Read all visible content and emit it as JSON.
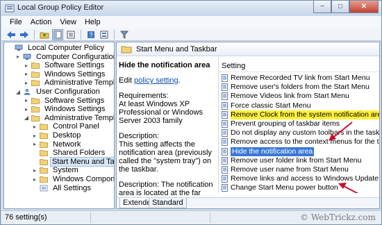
{
  "window": {
    "title": "Local Group Policy Editor",
    "controls": {
      "minimize": "−",
      "maximize": "□",
      "close": "✕"
    }
  },
  "menu": {
    "items": [
      "File",
      "Action",
      "View",
      "Help"
    ]
  },
  "toolbar": {
    "icons": [
      "back-arrow-icon",
      "forward-arrow-icon",
      "up-folder-icon",
      "show-hide-tree-icon",
      "export-list-icon",
      "help-icon",
      "properties-icon",
      "filter-icon"
    ]
  },
  "tree": {
    "items": [
      {
        "label": "Local Computer Policy",
        "level": 0,
        "icon": "computer-icon",
        "expander": ""
      },
      {
        "label": "Computer Configuration",
        "level": 1,
        "icon": "computer-icon",
        "expander": "▸"
      },
      {
        "label": "Software Settings",
        "level": 2,
        "icon": "folder-icon",
        "expander": "▸"
      },
      {
        "label": "Windows Settings",
        "level": 2,
        "icon": "folder-icon",
        "expander": "▸"
      },
      {
        "label": "Administrative Templates",
        "level": 2,
        "icon": "folder-icon",
        "expander": "▸"
      },
      {
        "label": "User Configuration",
        "level": 1,
        "icon": "user-icon",
        "expander": "◢"
      },
      {
        "label": "Software Settings",
        "level": 2,
        "icon": "folder-icon",
        "expander": "▸"
      },
      {
        "label": "Windows Settings",
        "level": 2,
        "icon": "folder-icon",
        "expander": "▸"
      },
      {
        "label": "Administrative Templates",
        "level": 2,
        "icon": "folder-icon",
        "expander": "◢"
      },
      {
        "label": "Control Panel",
        "level": 3,
        "icon": "folder-icon",
        "expander": "▸"
      },
      {
        "label": "Desktop",
        "level": 3,
        "icon": "folder-icon",
        "expander": "▸"
      },
      {
        "label": "Network",
        "level": 3,
        "icon": "folder-icon",
        "expander": "▸"
      },
      {
        "label": "Shared Folders",
        "level": 3,
        "icon": "folder-icon",
        "expander": ""
      },
      {
        "label": "Start Menu and Taskbar",
        "level": 3,
        "icon": "folder-icon",
        "expander": "",
        "selected": true
      },
      {
        "label": "System",
        "level": 3,
        "icon": "folder-icon",
        "expander": "▸"
      },
      {
        "label": "Windows Components",
        "level": 3,
        "icon": "folder-icon",
        "expander": "▸"
      },
      {
        "label": "All Settings",
        "level": 3,
        "icon": "settings-icon",
        "expander": ""
      }
    ]
  },
  "details": {
    "header": "Start Menu and Taskbar",
    "title": "Hide the notification area",
    "edit_prefix": "Edit ",
    "edit_link": "policy setting",
    "edit_suffix": ".",
    "requirements_label": "Requirements:",
    "requirements_text": "At least Windows XP Professional or Windows Server 2003 family",
    "description_label": "Description:",
    "description_text": "This setting affects the notification area (previously called the \"system tray\") on the taskbar.",
    "description_more": "Description: The notification area is located at the far right end of the task bar and includes the icons for current notifications and the system clock."
  },
  "settings": {
    "column_header": "Setting",
    "items": [
      {
        "label": "Remove Recorded TV link from Start Menu"
      },
      {
        "label": "Remove user's folders from the Start Menu"
      },
      {
        "label": "Remove Videos link from Start Menu"
      },
      {
        "label": "Force classic Start Menu"
      },
      {
        "label": "Remove Clock from the system notification area",
        "state": "highlight"
      },
      {
        "label": "Prevent grouping of taskbar items"
      },
      {
        "label": "Do not display any custom toolbars in the taskbar"
      },
      {
        "label": "Remove access to the context menus for the taskbar"
      },
      {
        "label": "Hide the notification area",
        "state": "selected"
      },
      {
        "label": "Remove user folder link from Start Menu"
      },
      {
        "label": "Remove user name from Start Menu"
      },
      {
        "label": "Remove links and access to Windows Update"
      },
      {
        "label": "Change Start Menu power button"
      }
    ]
  },
  "tabs": [
    "Extended",
    "Standard"
  ],
  "status": {
    "count": "76 setting(s)",
    "watermark": "© WebTrickz.com"
  },
  "colors": {
    "highlight": "#fff03a",
    "selection": "#3a78d6",
    "arrow": "#c8102e",
    "link": "#0a4fb0"
  }
}
